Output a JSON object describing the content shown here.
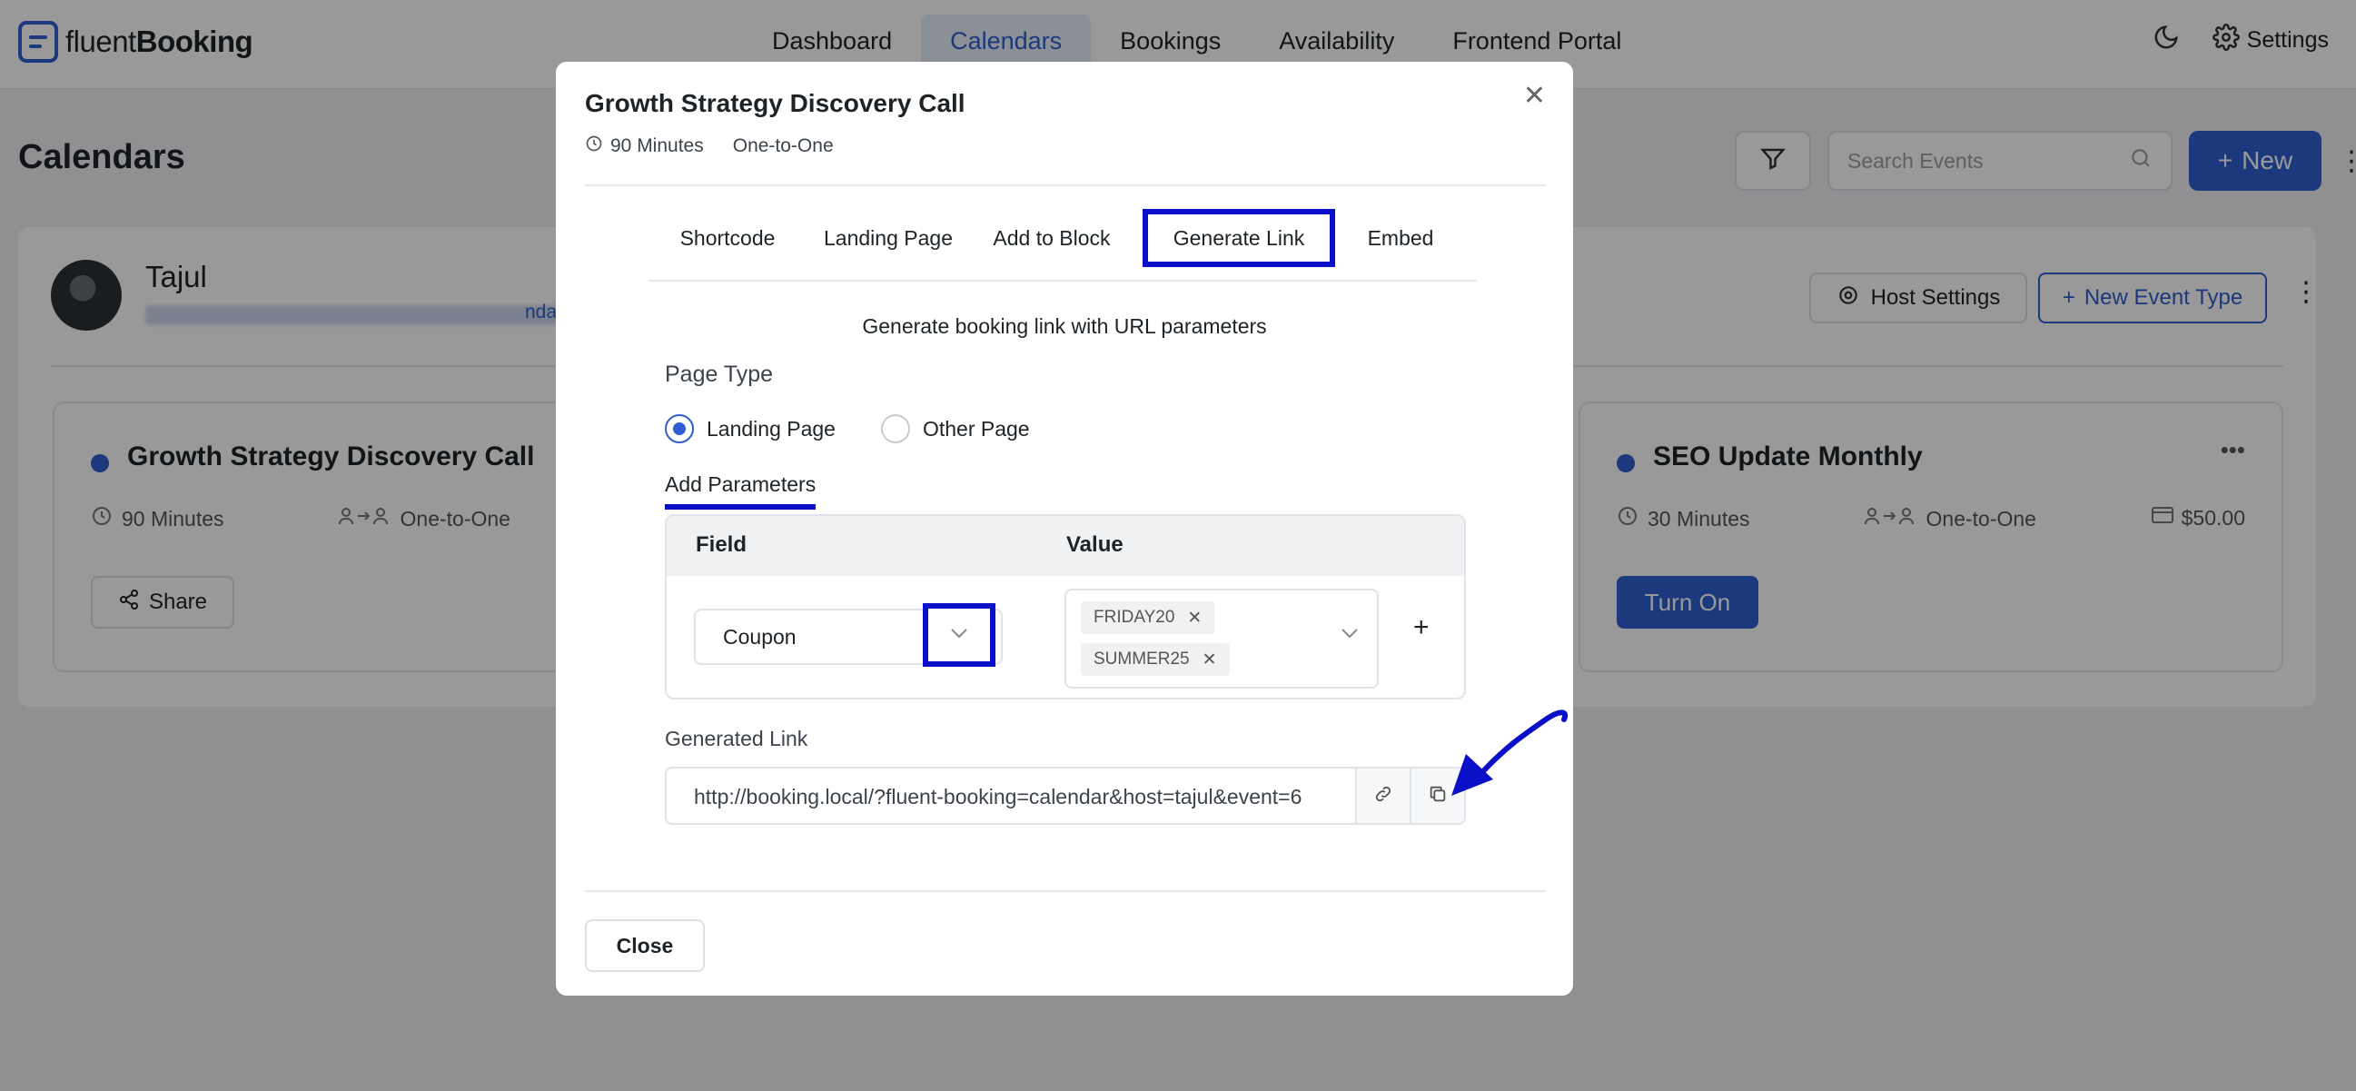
{
  "app": {
    "logo_prefix": "fluent",
    "logo_suffix": "Booking",
    "nav": [
      "Dashboard",
      "Calendars",
      "Bookings",
      "Availability",
      "Frontend Portal"
    ],
    "active_nav": "Calendars",
    "settings_label": "Settings"
  },
  "page": {
    "title": "Calendars",
    "search_placeholder": "Search Events",
    "new_button": "New"
  },
  "host": {
    "name": "Tajul",
    "link_tail": "ndar",
    "host_settings": "Host Settings",
    "new_event_type": "New Event Type"
  },
  "events": [
    {
      "title": "Growth Strategy Discovery Call",
      "duration": "90 Minutes",
      "type": "One-to-One",
      "action": "Share"
    },
    {
      "title": "SEO Update Monthly",
      "duration": "30 Minutes",
      "type": "One-to-One",
      "price": "$50.00",
      "action": "Turn On"
    }
  ],
  "modal": {
    "title": "Growth Strategy Discovery Call",
    "duration": "90 Minutes",
    "meeting_type": "One-to-One",
    "tabs": [
      "Shortcode",
      "Landing Page",
      "Add to Block",
      "Generate Link",
      "Embed"
    ],
    "active_tab": "Generate Link",
    "description": "Generate booking link with URL parameters",
    "page_type_label": "Page Type",
    "page_type_options": [
      "Landing Page",
      "Other Page"
    ],
    "page_type_selected": "Landing Page",
    "add_parameters_label": "Add Parameters",
    "table_headers": {
      "field": "Field",
      "value": "Value"
    },
    "param_row": {
      "field": "Coupon",
      "values": [
        "FRIDAY20",
        "SUMMER25"
      ]
    },
    "add_row": "+",
    "generated_link_label": "Generated Link",
    "generated_link": "http://booking.local/?fluent-booking=calendar&host=tajul&event=6",
    "close_button": "Close"
  },
  "colors": {
    "accent": "#2f5fd0",
    "annotation": "#0a0fc8"
  }
}
